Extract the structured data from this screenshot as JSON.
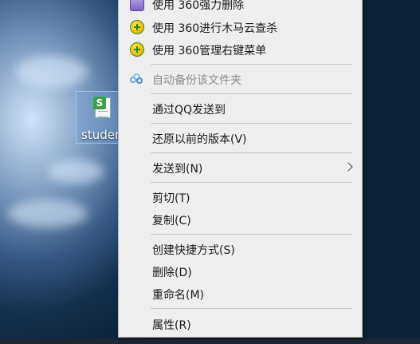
{
  "desktop": {
    "icon": {
      "badge": "S",
      "label": "studer"
    }
  },
  "context_menu": {
    "items": [
      {
        "label": "使用 360强力删除",
        "icon": "shredder-icon"
      },
      {
        "label": "使用 360进行木马云查杀",
        "icon": "plus-icon"
      },
      {
        "label": "使用 360管理右键菜单",
        "icon": "plus-icon"
      },
      {
        "label": "自动备份该文件夹",
        "icon": "cloud-backup-icon",
        "disabled": true
      },
      {
        "label": "通过QQ发送到"
      },
      {
        "label": "还原以前的版本(V)"
      },
      {
        "label": "发送到(N)",
        "submenu": true
      },
      {
        "label": "剪切(T)"
      },
      {
        "label": "复制(C)"
      },
      {
        "label": "创建快捷方式(S)"
      },
      {
        "label": "删除(D)"
      },
      {
        "label": "重命名(M)"
      },
      {
        "label": "属性(R)"
      }
    ]
  }
}
